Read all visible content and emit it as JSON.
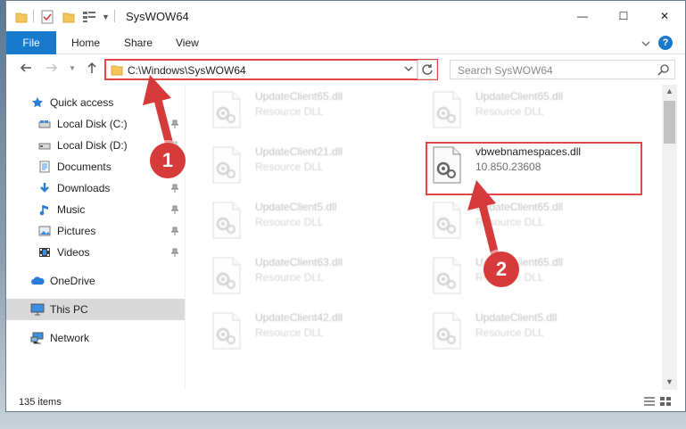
{
  "window": {
    "title": "SysWOW64",
    "minimize_symbol": "—",
    "maximize_symbol": "☐",
    "close_symbol": "✕"
  },
  "ribbon": {
    "tabs": [
      {
        "label": "File"
      },
      {
        "label": "Home"
      },
      {
        "label": "Share"
      },
      {
        "label": "View"
      }
    ],
    "help_symbol": "?"
  },
  "nav": {
    "address": "C:\\Windows\\SysWOW64",
    "search_placeholder": "Search SysWOW64"
  },
  "sidebar": {
    "items": [
      {
        "label": "Quick access",
        "icon": "star-icon"
      },
      {
        "label": "Local Disk (C:)",
        "icon": "drive-icon",
        "pinned": true
      },
      {
        "label": "Local Disk (D:)",
        "icon": "drive-icon",
        "pinned": true
      },
      {
        "label": "Documents",
        "icon": "documents-icon",
        "pinned": true
      },
      {
        "label": "Downloads",
        "icon": "downloads-icon",
        "pinned": true
      },
      {
        "label": "Music",
        "icon": "music-icon",
        "pinned": true
      },
      {
        "label": "Pictures",
        "icon": "pictures-icon",
        "pinned": true
      },
      {
        "label": "Videos",
        "icon": "videos-icon",
        "pinned": true
      },
      {
        "label": "OneDrive",
        "icon": "cloud-icon"
      },
      {
        "label": "This PC",
        "icon": "monitor-icon",
        "selected": true
      },
      {
        "label": "Network",
        "icon": "network-icon"
      }
    ]
  },
  "files": [
    {
      "name": "UpdateClient65.dll",
      "sub": "Resource DLL",
      "highlighted": false
    },
    {
      "name": "UpdateClient65.dll",
      "sub": "Resource DLL",
      "highlighted": false
    },
    {
      "name": "UpdateClient21.dll",
      "sub": "Resource DLL",
      "highlighted": false
    },
    {
      "name": "vbwebnamespaces.dll",
      "sub": "10.850.23608",
      "highlighted": true
    },
    {
      "name": "UpdateClient5.dll",
      "sub": "Resource DLL",
      "highlighted": false
    },
    {
      "name": "UpdateClient65.dll",
      "sub": "Resource DLL",
      "highlighted": false
    },
    {
      "name": "UpdateClient63.dll",
      "sub": "Resource DLL",
      "highlighted": false
    },
    {
      "name": "UpdateClient65.dll",
      "sub": "Resource DLL",
      "highlighted": false
    },
    {
      "name": "UpdateClient42.dll",
      "sub": "Resource DLL",
      "highlighted": false
    },
    {
      "name": "UpdateClient5.dll",
      "sub": "Resource DLL",
      "highlighted": false
    }
  ],
  "status": {
    "item_count": "135 items"
  },
  "annotations": {
    "badge_1": "1",
    "badge_2": "2",
    "color": "#d63a3a"
  },
  "colors": {
    "accent": "#1979ca",
    "highlight": "#e04848"
  }
}
